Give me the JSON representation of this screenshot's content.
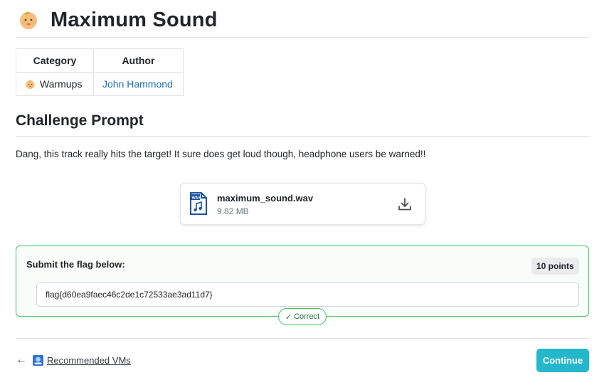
{
  "challenge": {
    "title": "Maximum Sound",
    "icon": "baby-face-icon"
  },
  "meta_table": {
    "headers": [
      "Category",
      "Author"
    ],
    "category": "Warmups",
    "category_icon": "baby-face-icon",
    "author": "John Hammond"
  },
  "prompt_section": {
    "title": "Challenge Prompt",
    "text": "Dang, this track really hits the target! It sure does get loud though, headphone users be warned!!"
  },
  "file": {
    "name": "maximum_sound.wav",
    "size": "9.82 MB",
    "icon": "wav-file-icon",
    "icon_tag": "WAV",
    "action_icon": "download-icon"
  },
  "flag_form": {
    "label": "Submit the flag below:",
    "points": "10 points",
    "value": "flag{d60ea9faec46c2de1c72533ae3ad11d7}",
    "status": "Correct",
    "status_color": "#47c26c"
  },
  "footer": {
    "back_arrow": "←",
    "link_label": "Recommended VMs",
    "continue_label": "Continue"
  },
  "colors": {
    "accent": "#25b8cc",
    "link": "#1f6fbf",
    "success": "#47c26c"
  }
}
